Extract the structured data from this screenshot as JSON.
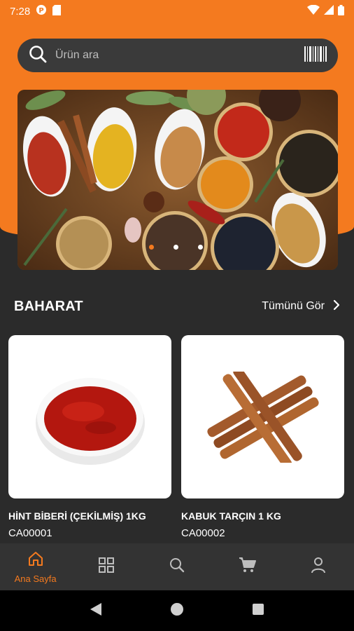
{
  "status_bar": {
    "time": "7:28",
    "icons_left": [
      "app-notification-icon",
      "sd-card-icon"
    ],
    "icons_right": [
      "wifi-icon",
      "signal-icon",
      "battery-icon"
    ]
  },
  "search": {
    "placeholder": "Ürün ara",
    "icon": "search-icon",
    "barcode_icon": "barcode-icon"
  },
  "banner": {
    "image": "spices-banner",
    "slides": 3,
    "active_slide": 1
  },
  "section": {
    "title": "BAHARAT",
    "see_all_label": "Tümünü Gör"
  },
  "products": [
    {
      "name": "HİNT BİBERİ (ÇEKİLMİŞ) 1KG",
      "code": "CA00001",
      "image": "ground-red-pepper-bowl"
    },
    {
      "name": "KABUK TARÇIN 1 KG",
      "code": "CA00002",
      "image": "cinnamon-sticks"
    }
  ],
  "bottom_nav": [
    {
      "label": "Ana Sayfa",
      "icon": "home-icon",
      "active": true
    },
    {
      "label": "",
      "icon": "categories-icon",
      "active": false
    },
    {
      "label": "",
      "icon": "search-icon",
      "active": false
    },
    {
      "label": "",
      "icon": "cart-icon",
      "active": false
    },
    {
      "label": "",
      "icon": "profile-icon",
      "active": false
    }
  ],
  "colors": {
    "accent": "#f47a1f",
    "background": "#2b2b2b",
    "nav_background": "#333333",
    "search_background": "#3a3a3a"
  }
}
